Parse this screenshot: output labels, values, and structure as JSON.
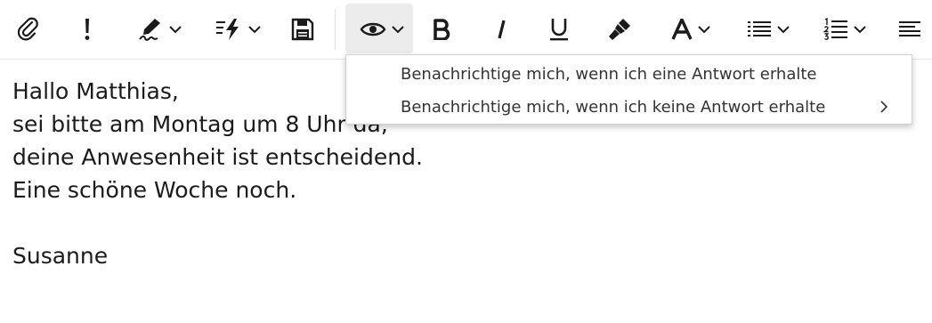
{
  "toolbar": {
    "buttons": [
      {
        "name": "attach",
        "icon": "paperclip-icon"
      },
      {
        "name": "importance",
        "icon": "exclamation-icon"
      },
      {
        "name": "signature",
        "icon": "signature-pen-icon"
      },
      {
        "name": "quick-parts",
        "icon": "lightning-list-icon"
      },
      {
        "name": "save",
        "icon": "floppy-disk-icon"
      },
      {
        "name": "tracking",
        "icon": "eye-icon"
      },
      {
        "name": "bold",
        "icon": "bold-icon"
      },
      {
        "name": "italic",
        "icon": "italic-icon"
      },
      {
        "name": "underline",
        "icon": "underline-icon"
      },
      {
        "name": "format-painter",
        "icon": "paintbrush-icon"
      },
      {
        "name": "font-color",
        "icon": "font-color-icon"
      },
      {
        "name": "bullets",
        "icon": "bulleted-list-icon"
      },
      {
        "name": "numbering",
        "icon": "numbered-list-icon"
      },
      {
        "name": "align",
        "icon": "align-left-icon"
      }
    ]
  },
  "tracking_menu": {
    "items": [
      {
        "label": "Benachrichtige mich, wenn ich eine Antwort erhalte",
        "has_submenu": false
      },
      {
        "label": "Benachrichtige mich, wenn ich keine Antwort erhalte",
        "has_submenu": true
      }
    ]
  },
  "body": {
    "lines": [
      "Hallo Matthias,",
      "sei bitte am Montag um 8 Uhr da,",
      "deine Anwesenheit ist entscheidend.",
      "Eine schöne Woche noch.",
      "",
      "Susanne"
    ]
  }
}
